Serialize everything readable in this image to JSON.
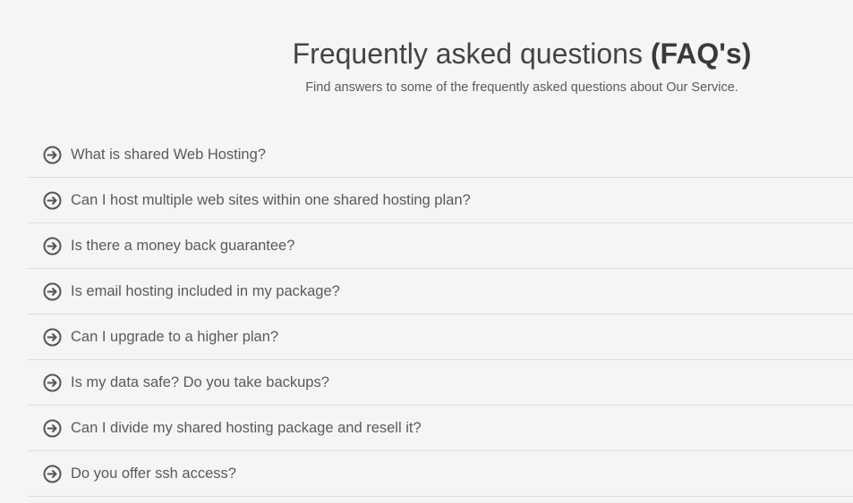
{
  "header": {
    "title_main": "Frequently asked questions ",
    "title_bold": "(FAQ's)",
    "subtitle": "Find answers to some of the frequently asked questions about Our Service."
  },
  "faq": {
    "icon": "arrow-circle-right-icon",
    "items": [
      {
        "question": "What is shared Web Hosting?"
      },
      {
        "question": "Can I host multiple web sites within one shared hosting plan?"
      },
      {
        "question": "Is there a money back guarantee?"
      },
      {
        "question": "Is email hosting included in my package?"
      },
      {
        "question": "Can I upgrade to a higher plan?"
      },
      {
        "question": "Is my data safe? Do you take backups?"
      },
      {
        "question": "Can I divide my shared hosting package and resell it?"
      },
      {
        "question": "Do you offer ssh access?"
      }
    ]
  },
  "colors": {
    "background": "#f5f5f5",
    "text": "#5a5a5a",
    "divider": "#dedede",
    "icon": "#555555"
  }
}
